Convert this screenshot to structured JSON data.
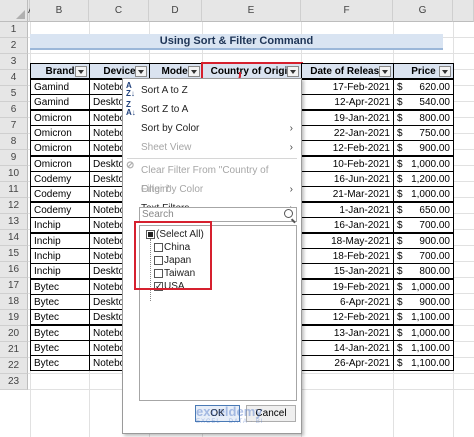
{
  "columns": [
    "A",
    "B",
    "C",
    "D",
    "E",
    "F",
    "G"
  ],
  "rows": [
    "1",
    "2",
    "3",
    "4",
    "5",
    "6",
    "7",
    "8",
    "9",
    "10",
    "11",
    "12",
    "13",
    "14",
    "15",
    "16",
    "17",
    "18",
    "19",
    "20",
    "21",
    "22",
    "23"
  ],
  "title": "Using Sort & Filter Command",
  "headers": {
    "brand": "Brand",
    "device": "Device",
    "model": "Model",
    "country": "Country of Origin",
    "date": "Date of Release",
    "price": "Price"
  },
  "currency_symbol": "$",
  "table": [
    {
      "brand": "Gamind",
      "device": "Notebo",
      "date": "17-Feb-2021",
      "price": "620.00"
    },
    {
      "brand": "Gamind",
      "device": "Deskto",
      "date": "12-Apr-2021",
      "price": "540.00"
    },
    {
      "brand": "Omicron",
      "device": "Notebo",
      "date": "19-Jan-2021",
      "price": "800.00"
    },
    {
      "brand": "Omicron",
      "device": "Notebo",
      "date": "22-Jan-2021",
      "price": "750.00"
    },
    {
      "brand": "Omicron",
      "device": "Notebo",
      "date": "12-Feb-2021",
      "price": "900.00"
    },
    {
      "brand": "Omicron",
      "device": "Deskto",
      "date": "10-Feb-2021",
      "price": "1,000.00"
    },
    {
      "brand": "Codemy",
      "device": "Deskto",
      "date": "16-Jun-2021",
      "price": "1,200.00"
    },
    {
      "brand": "Codemy",
      "device": "Notebo",
      "date": "21-Mar-2021",
      "price": "1,000.00"
    },
    {
      "brand": "Codemy",
      "device": "Notebo",
      "date": "1-Jan-2021",
      "price": "650.00"
    },
    {
      "brand": "Inchip",
      "device": "Notebo",
      "date": "16-Jan-2021",
      "price": "700.00"
    },
    {
      "brand": "Inchip",
      "device": "Notebo",
      "date": "18-May-2021",
      "price": "900.00"
    },
    {
      "brand": "Inchip",
      "device": "Notebo",
      "date": "18-Feb-2021",
      "price": "700.00"
    },
    {
      "brand": "Inchip",
      "device": "Deskto",
      "date": "15-Jan-2021",
      "price": "800.00"
    },
    {
      "brand": "Bytec",
      "device": "Notebo",
      "date": "19-Feb-2021",
      "price": "1,000.00"
    },
    {
      "brand": "Bytec",
      "device": "Deskto",
      "date": "6-Apr-2021",
      "price": "900.00"
    },
    {
      "brand": "Bytec",
      "device": "Deskto",
      "date": "12-Feb-2021",
      "price": "1,100.00"
    },
    {
      "brand": "Bytec",
      "device": "Notebo",
      "date": "13-Jan-2021",
      "price": "1,000.00"
    },
    {
      "brand": "Bytec",
      "device": "Notebo",
      "date": "14-Jan-2021",
      "price": "1,100.00"
    },
    {
      "brand": "Bytec",
      "device": "Notebo",
      "date": "26-Apr-2021",
      "price": "1,100.00"
    }
  ],
  "menu": {
    "sort_az": "Sort A to Z",
    "sort_za": "Sort Z to A",
    "sort_by_color": "Sort by Color",
    "sheet_view": "Sheet View",
    "clear_filter": "Clear Filter From \"Country of Origin\"",
    "filter_by_color": "Filter by Color",
    "text_filters": "Text Filters",
    "search_placeholder": "Search",
    "options": [
      {
        "label": "(Select All)",
        "state": "partial"
      },
      {
        "label": "China",
        "state": "unchecked"
      },
      {
        "label": "Japan",
        "state": "unchecked"
      },
      {
        "label": "Taiwan",
        "state": "unchecked"
      },
      {
        "label": "USA",
        "state": "checked"
      }
    ],
    "ok_label": "OK",
    "cancel_label": "Cancel"
  },
  "watermark": {
    "name": "exceldemy",
    "tagline": "EXCEL · DATA · BI"
  },
  "colors": {
    "highlight": "#d6202e",
    "header_fill": "#dae3f0",
    "title_fill": "#d9e4f2"
  }
}
